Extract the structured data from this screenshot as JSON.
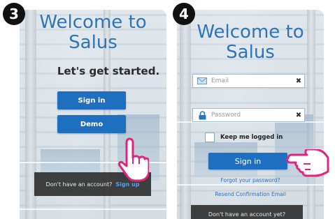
{
  "steps": {
    "left_number": "3",
    "right_number": "4"
  },
  "left_screen": {
    "title_line1": "Welcome to",
    "title_line2": "Salus",
    "subtitle": "Let's get started.",
    "signin_label": "Sign in",
    "demo_label": "Demo",
    "bottom_text": "Don't have an account?",
    "bottom_link": "Sign up"
  },
  "right_screen": {
    "title_line1": "Welcome to",
    "title_line2": "Salus",
    "email_placeholder": "Email",
    "password_placeholder": "Password",
    "keep_logged_label": "Keep me logged in",
    "signin_label": "Sign in",
    "forgot_link": "Forgot your password?",
    "resend_link": "Resend Confirmation Email",
    "bottom_text": "Don't have an account yet?"
  },
  "colors": {
    "accent": "#2f74b7",
    "button": "#1f6fc0",
    "link": "#5aa0e6",
    "hand": "#e0237d"
  },
  "icons": {
    "email": "envelope-icon",
    "password": "padlock-icon",
    "clear": "x-icon",
    "pointer": "pointing-hand-icon"
  }
}
